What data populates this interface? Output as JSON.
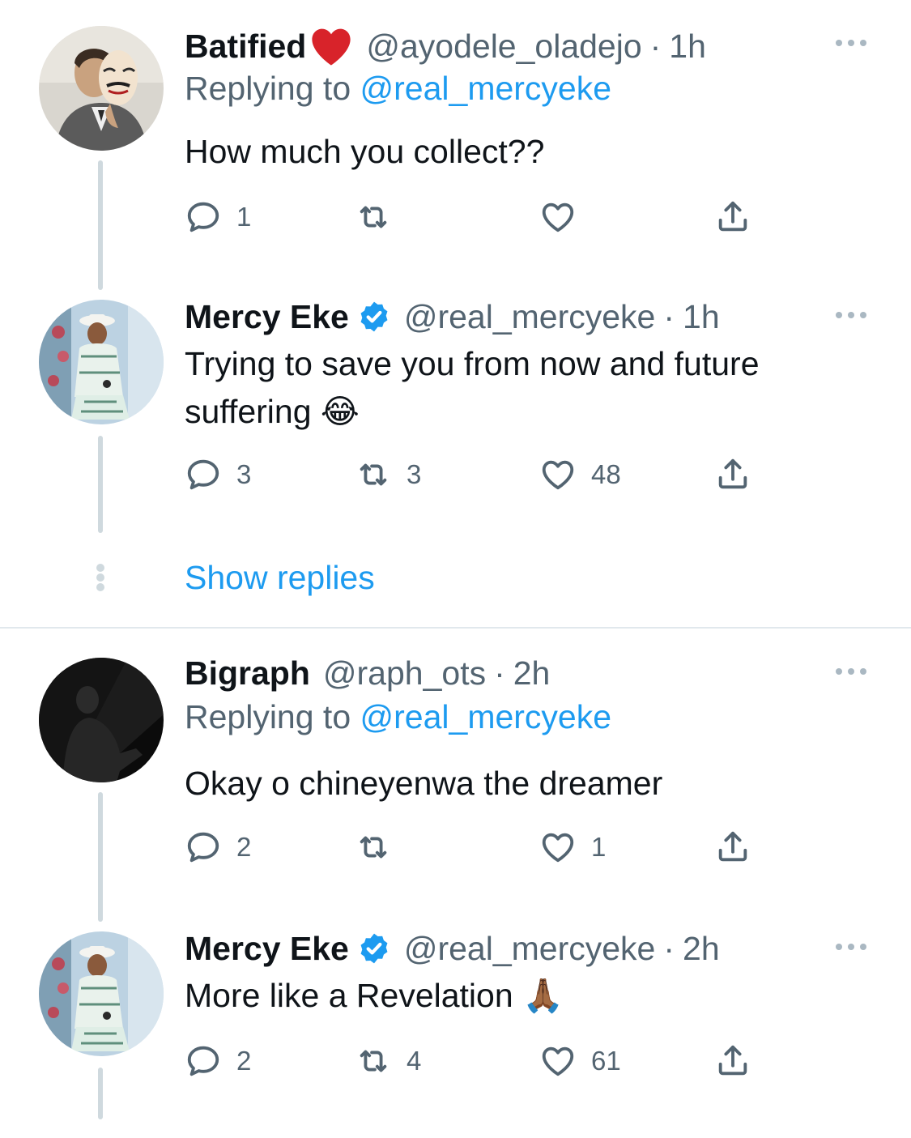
{
  "colors": {
    "accent": "#1d9bf0",
    "muted": "#536471",
    "text": "#0f1419",
    "line": "#cfd9de"
  },
  "tweets": [
    {
      "name": "Batified",
      "badge": "heart",
      "handle": "@ayodele_oladejo",
      "dot": "·",
      "time": "1h",
      "replying_label": "Replying to",
      "replying_to": "@real_mercyeke",
      "text": "How much you collect??",
      "replies": "1",
      "retweets": "",
      "likes": "",
      "avatar_icon": "masked-man-avatar"
    },
    {
      "name": "Mercy Eke",
      "badge": "verified",
      "handle": "@real_mercyeke",
      "dot": "·",
      "time": "1h",
      "text": "Trying to save you from now and future suffering 😂",
      "replies": "3",
      "retweets": "3",
      "likes": "48",
      "avatar_icon": "seated-woman-avatar"
    },
    {
      "name": "Bigraph",
      "handle": "@raph_ots",
      "dot": "·",
      "time": "2h",
      "replying_label": "Replying to",
      "replying_to": "@real_mercyeke",
      "text": "Okay o chineyenwa the dreamer",
      "replies": "2",
      "retweets": "",
      "likes": "1",
      "avatar_icon": "dark-silhouette-avatar"
    },
    {
      "name": "Mercy Eke",
      "badge": "verified",
      "handle": "@real_mercyeke",
      "dot": "·",
      "time": "2h",
      "text": "More like a Revelation 🙏🏾",
      "replies": "2",
      "retweets": "4",
      "likes": "61",
      "avatar_icon": "seated-woman-avatar"
    }
  ],
  "show_replies": "Show replies"
}
